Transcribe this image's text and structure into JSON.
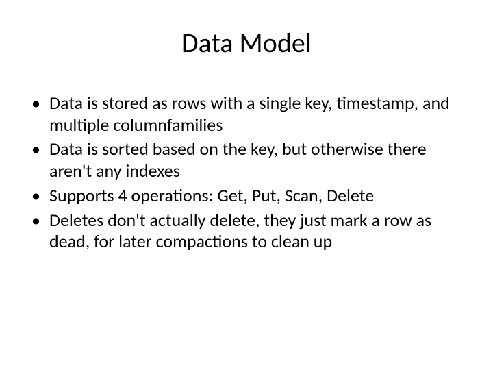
{
  "slide": {
    "title": "Data Model",
    "bullets": [
      "Data is stored as rows with a single key, timestamp, and multiple columnfamilies",
      "Data is sorted based on the key, but otherwise there aren't any indexes",
      "Supports 4 operations: Get, Put, Scan, Delete",
      "Deletes don't actually delete, they just mark a row as dead, for later compactions to clean up"
    ]
  }
}
